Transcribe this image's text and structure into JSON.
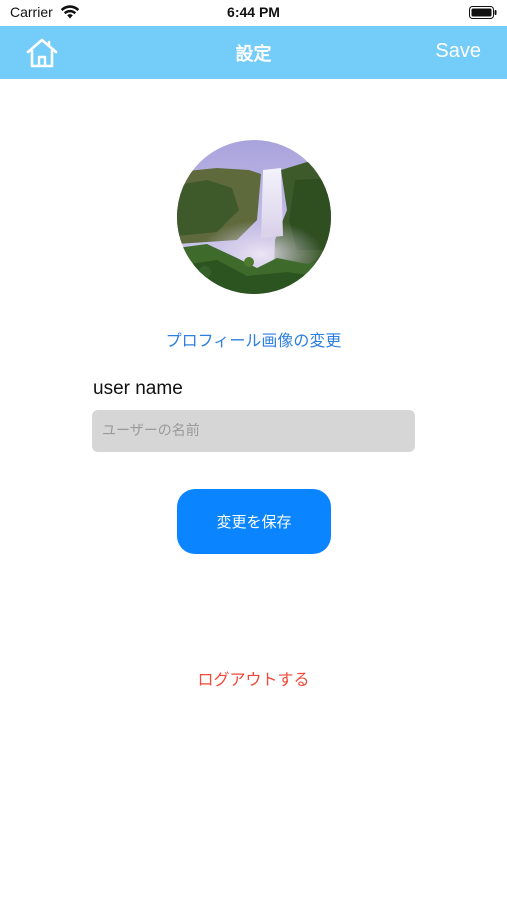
{
  "status_bar": {
    "carrier": "Carrier",
    "time": "6:44 PM",
    "wifi_icon": "wifi-icon",
    "battery_icon": "battery-full-icon"
  },
  "nav_bar": {
    "background": "#74ccf8",
    "home_icon": "home-icon",
    "title": "設定",
    "save_label": "Save"
  },
  "profile": {
    "avatar_image": "waterfall-photo",
    "change_photo_label": "プロフィール画像の変更"
  },
  "form": {
    "username_label": "user name",
    "username_value": "",
    "username_placeholder": "ユーザーの名前",
    "save_changes_label": "変更を保存",
    "save_changes_color": "#0a84ff"
  },
  "logout": {
    "label": "ログアウトする",
    "color": "#ef4a3a"
  }
}
